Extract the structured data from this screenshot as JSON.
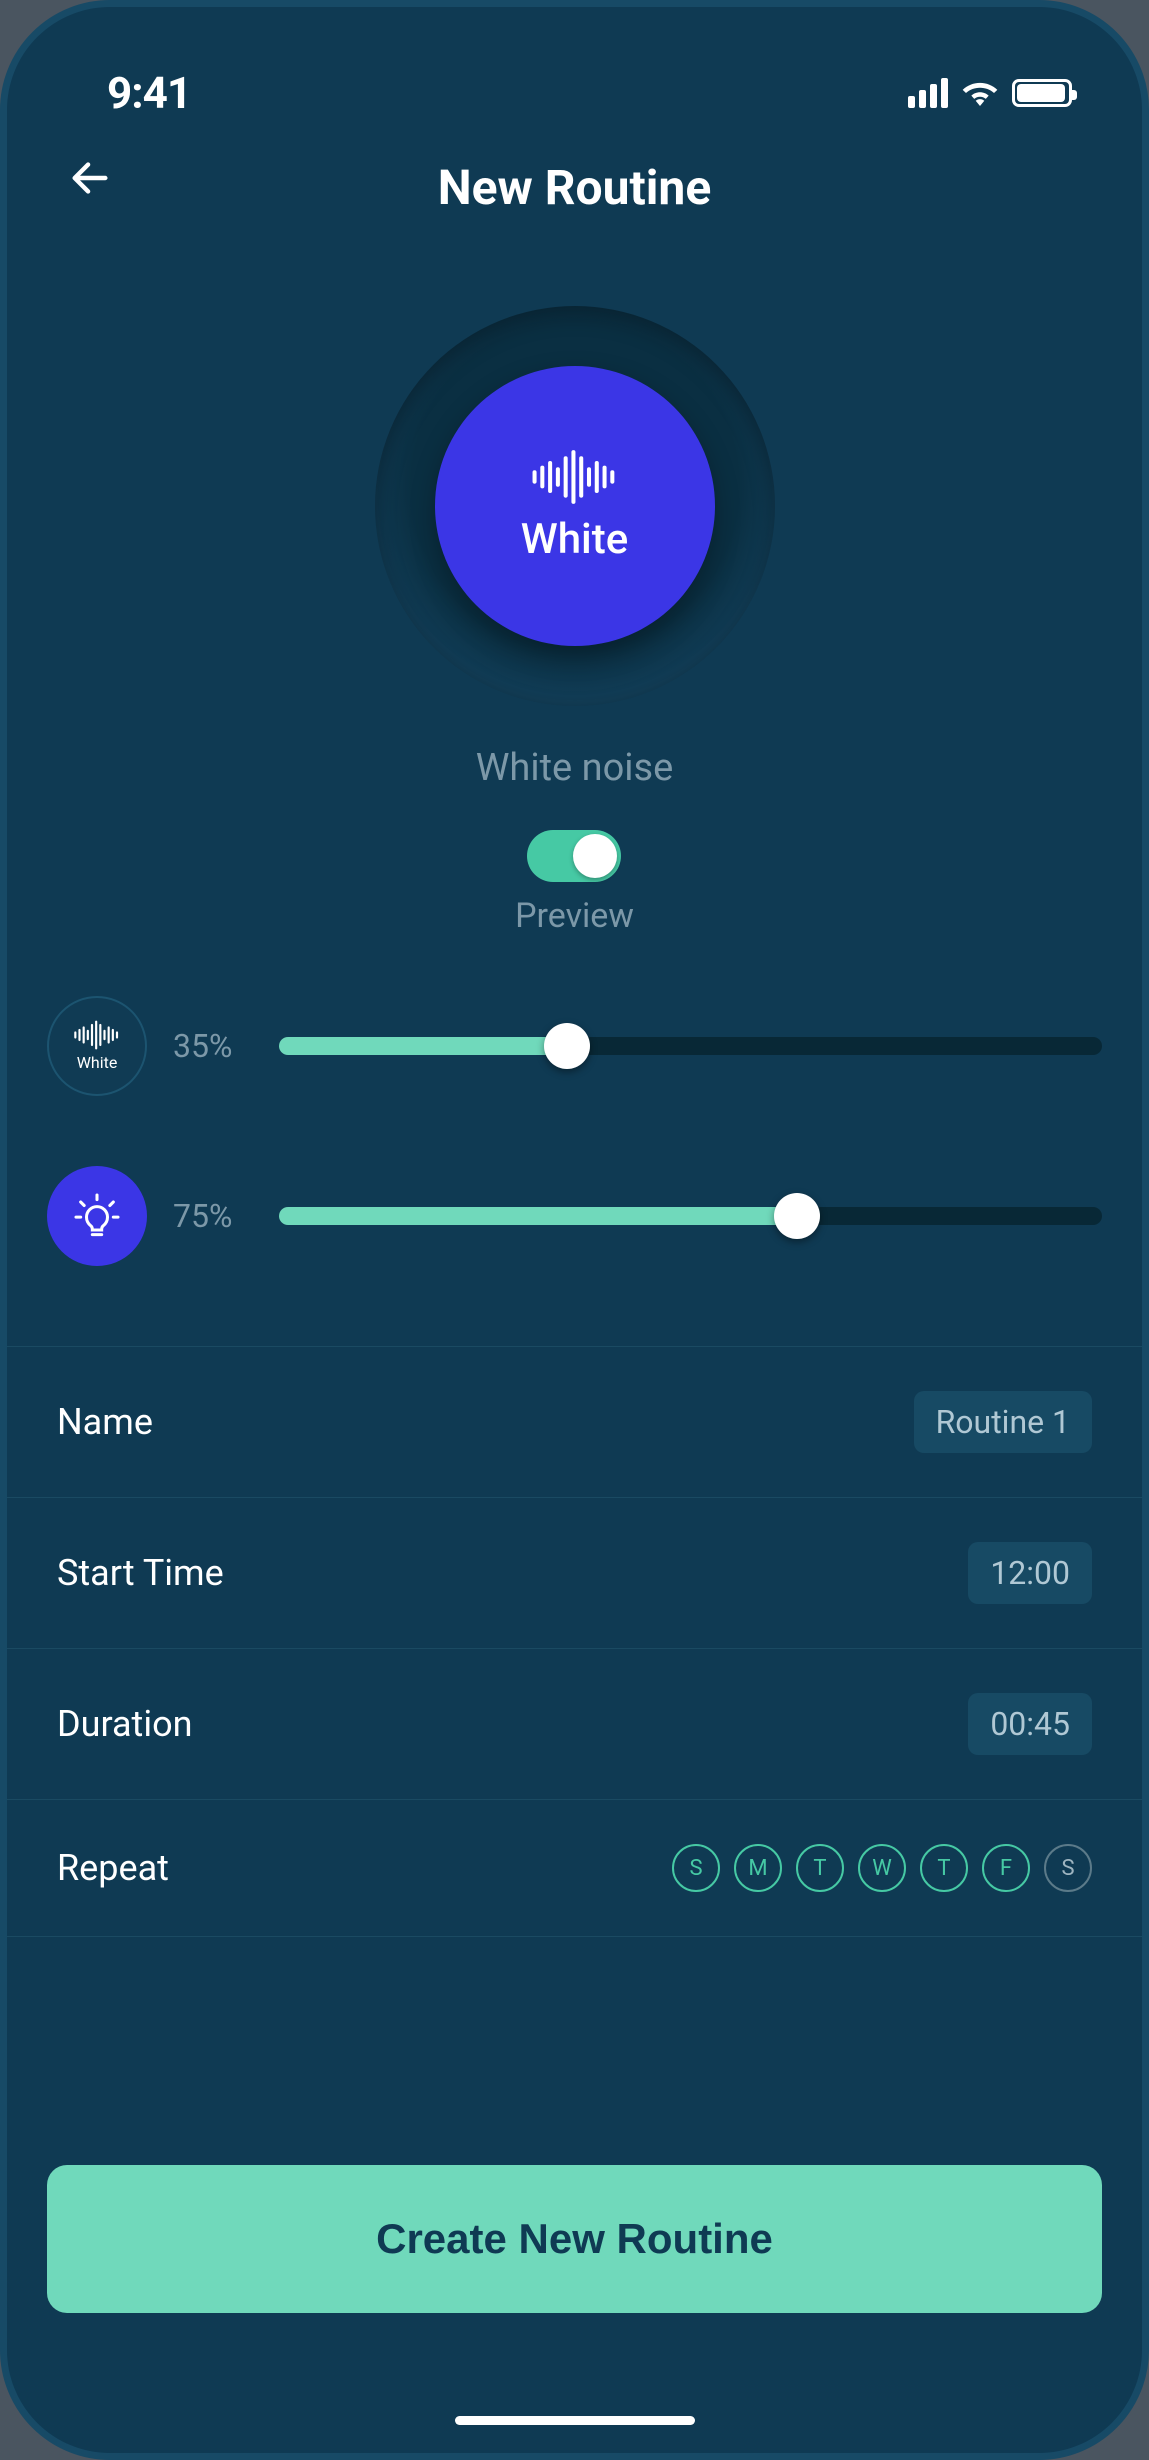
{
  "statusbar": {
    "time": "9:41"
  },
  "header": {
    "title": "New Routine"
  },
  "sound": {
    "dial_label": "White",
    "subtitle": "White noise",
    "preview_label": "Preview"
  },
  "sliders": {
    "sound": {
      "pct_label": "35%",
      "pct": 35,
      "mini_label": "White"
    },
    "light": {
      "pct_label": "75%",
      "pct": 75
    }
  },
  "rows": {
    "name": {
      "label": "Name",
      "value": "Routine 1"
    },
    "start_time": {
      "label": "Start Time",
      "value": "12:00"
    },
    "duration": {
      "label": "Duration",
      "value": "00:45"
    },
    "repeat": {
      "label": "Repeat"
    }
  },
  "days": {
    "d0": "S",
    "d1": "M",
    "d2": "T",
    "d3": "W",
    "d4": "T",
    "d5": "F",
    "d6": "S"
  },
  "cta": {
    "label": "Create New Routine"
  }
}
